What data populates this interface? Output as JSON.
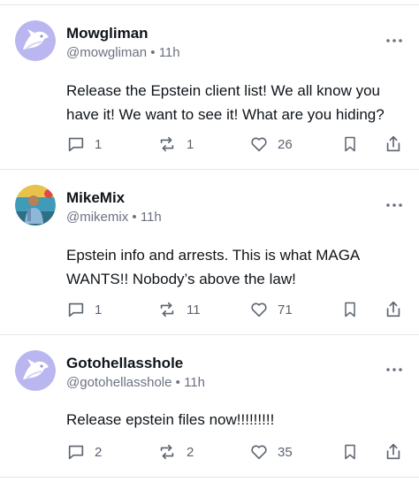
{
  "posts": [
    {
      "name": "Mowgliman",
      "handle": "@mowgliman",
      "time": "11h",
      "text": "Release the Epstein client list! We all know you have it! We want to see it! What are you hiding?",
      "replies": "1",
      "reposts": "1",
      "likes": "26",
      "avatar": "default-bird-avatar"
    },
    {
      "name": "MikeMix",
      "handle": "@mikemix",
      "time": "11h",
      "text": "Epstein info and arrests. This is what MAGA WANTS!! Nobody’s above the law!",
      "replies": "1",
      "reposts": "11",
      "likes": "71",
      "avatar": "photo-avatar"
    },
    {
      "name": "Gotohellasshole",
      "handle": "@gotohellasshole",
      "time": "11h",
      "text": "Release epstein files now!!!!!!!!!",
      "replies": "2",
      "reposts": "2",
      "likes": "35",
      "avatar": "default-bird-avatar"
    }
  ],
  "separator": " • ",
  "icons": [
    "reply-icon",
    "repost-icon",
    "like-icon",
    "bookmark-icon",
    "share-icon",
    "more-icon"
  ],
  "colors": {
    "avatar_bg": "#b9b6f0",
    "muted": "#6b7280",
    "divider": "#e5e7eb"
  }
}
